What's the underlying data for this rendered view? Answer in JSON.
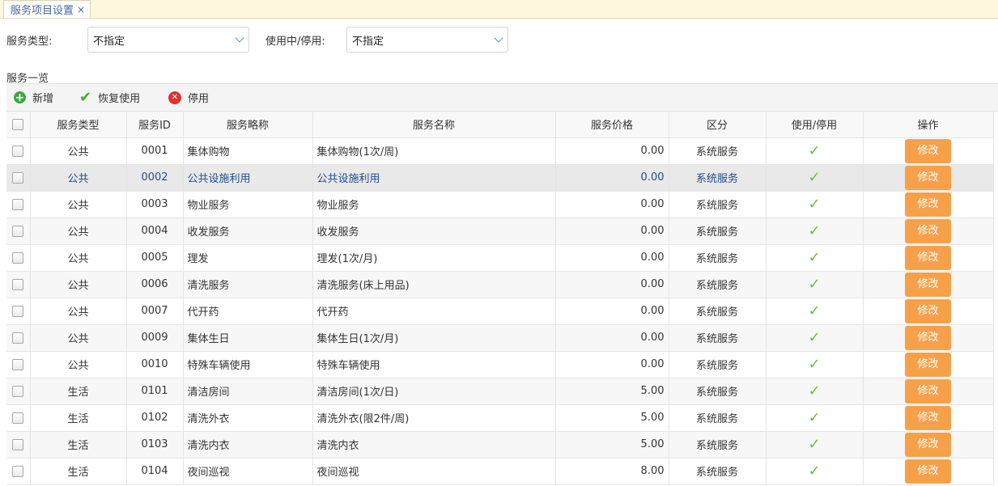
{
  "tab": {
    "label": "服务项目设置",
    "close": "×"
  },
  "filters": {
    "service_type": {
      "label": "服务类型:",
      "value": "不指定"
    },
    "status": {
      "label": "使用中/停用:",
      "value": "不指定"
    }
  },
  "section_title": "服务一览",
  "toolbar": {
    "add": "新增",
    "restore": "恢复使用",
    "disable": "停用"
  },
  "icons": {
    "add": "plus-circle-icon",
    "restore": "check-icon",
    "disable": "stop-circle-icon"
  },
  "colors": {
    "edit_button": "#f7a04a",
    "check": "#6abf3a",
    "tab_bar": "#fdf7dd"
  },
  "table": {
    "columns": [
      "服务类型",
      "服务ID",
      "服务略称",
      "服务名称",
      "服务价格",
      "区分",
      "使用/停用",
      "操作"
    ],
    "edit_label": "修改",
    "enabled_mark": "✓",
    "rows": [
      {
        "type": "公共",
        "id": "0001",
        "short": "集体购物",
        "name": "集体购物(1次/周)",
        "price": "0.00",
        "category": "系统服务"
      },
      {
        "type": "公共",
        "id": "0002",
        "short": "公共设施利用",
        "name": "公共设施利用",
        "price": "0.00",
        "category": "系统服务"
      },
      {
        "type": "公共",
        "id": "0003",
        "short": "物业服务",
        "name": "物业服务",
        "price": "0.00",
        "category": "系统服务"
      },
      {
        "type": "公共",
        "id": "0004",
        "short": "收发服务",
        "name": "收发服务",
        "price": "0.00",
        "category": "系统服务"
      },
      {
        "type": "公共",
        "id": "0005",
        "short": "理发",
        "name": "理发(1次/月)",
        "price": "0.00",
        "category": "系统服务"
      },
      {
        "type": "公共",
        "id": "0006",
        "short": "清洗服务",
        "name": "清洗服务(床上用品)",
        "price": "0.00",
        "category": "系统服务"
      },
      {
        "type": "公共",
        "id": "0007",
        "short": "代开药",
        "name": "代开药",
        "price": "0.00",
        "category": "系统服务"
      },
      {
        "type": "公共",
        "id": "0009",
        "short": "集体生日",
        "name": "集体生日(1次/月)",
        "price": "0.00",
        "category": "系统服务"
      },
      {
        "type": "公共",
        "id": "0010",
        "short": "特殊车辆使用",
        "name": "特殊车辆使用",
        "price": "0.00",
        "category": "系统服务"
      },
      {
        "type": "生活",
        "id": "0101",
        "short": "清洁房间",
        "name": "清洁房间(1次/日)",
        "price": "5.00",
        "category": "系统服务"
      },
      {
        "type": "生活",
        "id": "0102",
        "short": "清洗外衣",
        "name": "清洗外衣(限2件/周)",
        "price": "5.00",
        "category": "系统服务"
      },
      {
        "type": "生活",
        "id": "0103",
        "short": "清洗内衣",
        "name": "清洗内衣",
        "price": "5.00",
        "category": "系统服务"
      },
      {
        "type": "生活",
        "id": "0104",
        "short": "夜间巡视",
        "name": "夜间巡视",
        "price": "8.00",
        "category": "系统服务"
      }
    ]
  }
}
